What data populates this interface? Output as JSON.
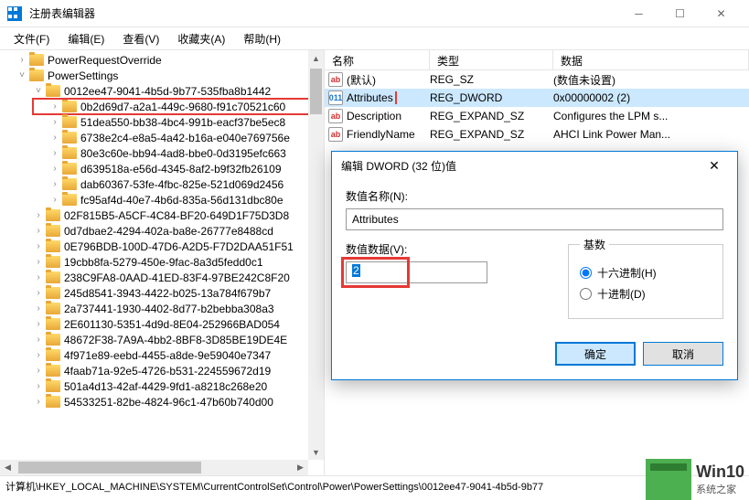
{
  "window": {
    "title": "注册表编辑器"
  },
  "menu": {
    "file": "文件(F)",
    "edit": "编辑(E)",
    "view": "查看(V)",
    "favorites": "收藏夹(A)",
    "help": "帮助(H)"
  },
  "tree": {
    "items": [
      {
        "indent": 1,
        "expander": ">",
        "label": "PowerRequestOverride"
      },
      {
        "indent": 1,
        "expander": "v",
        "label": "PowerSettings"
      },
      {
        "indent": 2,
        "expander": "v",
        "label": "0012ee47-9041-4b5d-9b77-535fba8b1442"
      },
      {
        "indent": 3,
        "expander": ">",
        "label": "0b2d69d7-a2a1-449c-9680-f91c70521c60",
        "highlighted": true
      },
      {
        "indent": 3,
        "expander": ">",
        "label": "51dea550-bb38-4bc4-991b-eacf37be5ec8"
      },
      {
        "indent": 3,
        "expander": ">",
        "label": "6738e2c4-e8a5-4a42-b16a-e040e769756e"
      },
      {
        "indent": 3,
        "expander": ">",
        "label": "80e3c60e-bb94-4ad8-bbe0-0d3195efc663"
      },
      {
        "indent": 3,
        "expander": ">",
        "label": "d639518a-e56d-4345-8af2-b9f32fb26109"
      },
      {
        "indent": 3,
        "expander": ">",
        "label": "dab60367-53fe-4fbc-825e-521d069d2456"
      },
      {
        "indent": 3,
        "expander": ">",
        "label": "fc95af4d-40e7-4b6d-835a-56d131dbc80e"
      },
      {
        "indent": 2,
        "expander": ">",
        "label": "02F815B5-A5CF-4C84-BF20-649D1F75D3D8"
      },
      {
        "indent": 2,
        "expander": ">",
        "label": "0d7dbae2-4294-402a-ba8e-26777e8488cd"
      },
      {
        "indent": 2,
        "expander": ">",
        "label": "0E796BDB-100D-47D6-A2D5-F7D2DAA51F51"
      },
      {
        "indent": 2,
        "expander": ">",
        "label": "19cbb8fa-5279-450e-9fac-8a3d5fedd0c1"
      },
      {
        "indent": 2,
        "expander": ">",
        "label": "238C9FA8-0AAD-41ED-83F4-97BE242C8F20"
      },
      {
        "indent": 2,
        "expander": ">",
        "label": "245d8541-3943-4422-b025-13a784f679b7"
      },
      {
        "indent": 2,
        "expander": ">",
        "label": "2a737441-1930-4402-8d77-b2bebba308a3"
      },
      {
        "indent": 2,
        "expander": ">",
        "label": "2E601130-5351-4d9d-8E04-252966BAD054"
      },
      {
        "indent": 2,
        "expander": ">",
        "label": "48672F38-7A9A-4bb2-8BF8-3D85BE19DE4E"
      },
      {
        "indent": 2,
        "expander": ">",
        "label": "4f971e89-eebd-4455-a8de-9e59040e7347"
      },
      {
        "indent": 2,
        "expander": ">",
        "label": "4faab71a-92e5-4726-b531-224559672d19"
      },
      {
        "indent": 2,
        "expander": ">",
        "label": "501a4d13-42af-4429-9fd1-a8218c268e20"
      },
      {
        "indent": 2,
        "expander": ">",
        "label": "54533251-82be-4824-96c1-47b60b740d00"
      }
    ]
  },
  "list": {
    "headers": {
      "name": "名称",
      "type": "类型",
      "data": "数据"
    },
    "rows": [
      {
        "icon": "string",
        "name": "(默认)",
        "type": "REG_SZ",
        "data": "(数值未设置)"
      },
      {
        "icon": "binary",
        "name": "Attributes",
        "type": "REG_DWORD",
        "data": "0x00000002 (2)",
        "selected": true,
        "highlighted": true
      },
      {
        "icon": "string",
        "name": "Description",
        "type": "REG_EXPAND_SZ",
        "data": "Configures the LPM s..."
      },
      {
        "icon": "string",
        "name": "FriendlyName",
        "type": "REG_EXPAND_SZ",
        "data": "AHCI Link Power Man..."
      }
    ]
  },
  "dialog": {
    "title": "编辑 DWORD (32 位)值",
    "name_label": "数值名称(N):",
    "name_value": "Attributes",
    "data_label": "数值数据(V):",
    "data_value": "2",
    "base_label": "基数",
    "radio_hex": "十六进制(H)",
    "radio_dec": "十进制(D)",
    "ok": "确定",
    "cancel": "取消"
  },
  "statusbar": {
    "path": "计算机\\HKEY_LOCAL_MACHINE\\SYSTEM\\CurrentControlSet\\Control\\Power\\PowerSettings\\0012ee47-9041-4b5d-9b77"
  },
  "watermark": {
    "big": "Win10",
    "small": "系统之家"
  }
}
